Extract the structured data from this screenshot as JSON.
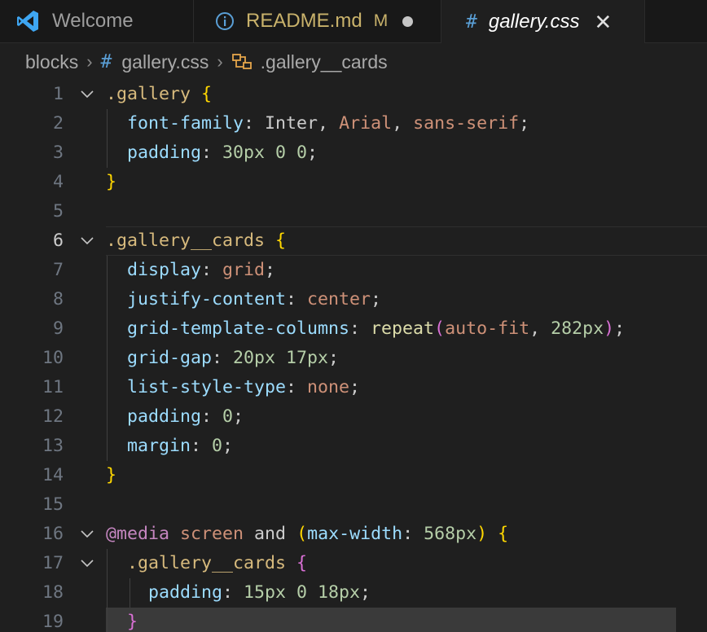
{
  "tabs": [
    {
      "label": "Welcome",
      "icon": "vscode-icon"
    },
    {
      "label": "README.md",
      "icon": "info-icon",
      "badge": "M"
    },
    {
      "label": "gallery.css",
      "icon": "css-hash-icon"
    }
  ],
  "breadcrumb": {
    "items": [
      "blocks",
      "gallery.css",
      ".gallery__cards"
    ]
  },
  "editor": {
    "current_line": 6,
    "lines": [
      {
        "n": "1",
        "tokens": [
          {
            "t": ".gallery",
            "c": "sel"
          },
          {
            "t": " ",
            "c": "punct"
          },
          {
            "t": "{",
            "c": "b1"
          }
        ]
      },
      {
        "n": "2",
        "tokens": [
          {
            "t": "  font-family",
            "c": "prop"
          },
          {
            "t": ": ",
            "c": "punct"
          },
          {
            "t": "Inter",
            "c": "kw"
          },
          {
            "t": ", ",
            "c": "punct"
          },
          {
            "t": "Arial",
            "c": "val"
          },
          {
            "t": ", ",
            "c": "punct"
          },
          {
            "t": "sans-serif",
            "c": "val"
          },
          {
            "t": ";",
            "c": "punct"
          }
        ]
      },
      {
        "n": "3",
        "tokens": [
          {
            "t": "  padding",
            "c": "prop"
          },
          {
            "t": ": ",
            "c": "punct"
          },
          {
            "t": "30px 0 0",
            "c": "num"
          },
          {
            "t": ";",
            "c": "punct"
          }
        ]
      },
      {
        "n": "4",
        "tokens": [
          {
            "t": "}",
            "c": "b1"
          }
        ]
      },
      {
        "n": "5",
        "tokens": []
      },
      {
        "n": "6",
        "tokens": [
          {
            "t": ".gallery__cards",
            "c": "sel"
          },
          {
            "t": " ",
            "c": "punct"
          },
          {
            "t": "{",
            "c": "b1"
          }
        ]
      },
      {
        "n": "7",
        "tokens": [
          {
            "t": "  display",
            "c": "prop"
          },
          {
            "t": ": ",
            "c": "punct"
          },
          {
            "t": "grid",
            "c": "val"
          },
          {
            "t": ";",
            "c": "punct"
          }
        ]
      },
      {
        "n": "8",
        "tokens": [
          {
            "t": "  justify-content",
            "c": "prop"
          },
          {
            "t": ": ",
            "c": "punct"
          },
          {
            "t": "center",
            "c": "val"
          },
          {
            "t": ";",
            "c": "punct"
          }
        ]
      },
      {
        "n": "9",
        "tokens": [
          {
            "t": "  grid-template-columns",
            "c": "prop"
          },
          {
            "t": ": ",
            "c": "punct"
          },
          {
            "t": "repeat",
            "c": "fn"
          },
          {
            "t": "(",
            "c": "b2"
          },
          {
            "t": "auto-fit",
            "c": "val"
          },
          {
            "t": ", ",
            "c": "punct"
          },
          {
            "t": "282px",
            "c": "num"
          },
          {
            "t": ")",
            "c": "b2"
          },
          {
            "t": ";",
            "c": "punct"
          }
        ]
      },
      {
        "n": "10",
        "tokens": [
          {
            "t": "  grid-gap",
            "c": "prop"
          },
          {
            "t": ": ",
            "c": "punct"
          },
          {
            "t": "20px 17px",
            "c": "num"
          },
          {
            "t": ";",
            "c": "punct"
          }
        ]
      },
      {
        "n": "11",
        "tokens": [
          {
            "t": "  list-style-type",
            "c": "prop"
          },
          {
            "t": ": ",
            "c": "punct"
          },
          {
            "t": "none",
            "c": "val"
          },
          {
            "t": ";",
            "c": "punct"
          }
        ]
      },
      {
        "n": "12",
        "tokens": [
          {
            "t": "  padding",
            "c": "prop"
          },
          {
            "t": ": ",
            "c": "punct"
          },
          {
            "t": "0",
            "c": "num"
          },
          {
            "t": ";",
            "c": "punct"
          }
        ]
      },
      {
        "n": "13",
        "tokens": [
          {
            "t": "  margin",
            "c": "prop"
          },
          {
            "t": ": ",
            "c": "punct"
          },
          {
            "t": "0",
            "c": "num"
          },
          {
            "t": ";",
            "c": "punct"
          }
        ]
      },
      {
        "n": "14",
        "tokens": [
          {
            "t": "}",
            "c": "b1"
          }
        ]
      },
      {
        "n": "15",
        "tokens": []
      },
      {
        "n": "16",
        "tokens": [
          {
            "t": "@media",
            "c": "at"
          },
          {
            "t": " ",
            "c": "punct"
          },
          {
            "t": "screen",
            "c": "val"
          },
          {
            "t": " and ",
            "c": "kw"
          },
          {
            "t": "(",
            "c": "b1"
          },
          {
            "t": "max-width",
            "c": "prop"
          },
          {
            "t": ": ",
            "c": "punct"
          },
          {
            "t": "568px",
            "c": "num"
          },
          {
            "t": ")",
            "c": "b1"
          },
          {
            "t": " ",
            "c": "punct"
          },
          {
            "t": "{",
            "c": "b1"
          }
        ]
      },
      {
        "n": "17",
        "tokens": [
          {
            "t": "  .gallery__cards",
            "c": "sel"
          },
          {
            "t": " ",
            "c": "punct"
          },
          {
            "t": "{",
            "c": "b2"
          }
        ]
      },
      {
        "n": "18",
        "tokens": [
          {
            "t": "    padding",
            "c": "prop"
          },
          {
            "t": ": ",
            "c": "punct"
          },
          {
            "t": "15px 0 18px",
            "c": "num"
          },
          {
            "t": ";",
            "c": "punct"
          }
        ]
      },
      {
        "n": "19",
        "tokens": [
          {
            "t": "  }",
            "c": "b2"
          }
        ]
      }
    ]
  }
}
